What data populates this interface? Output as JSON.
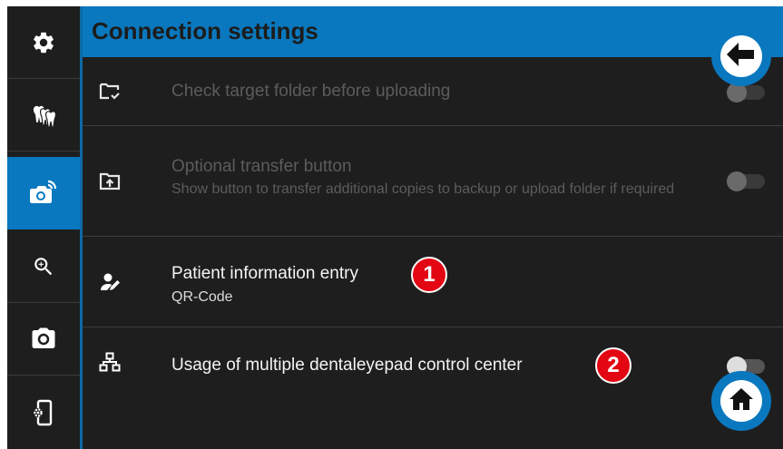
{
  "header": {
    "title": "Connection settings"
  },
  "sidebar": {
    "items": [
      {
        "icon": "gear-icon",
        "active": false
      },
      {
        "icon": "teeth-icon",
        "active": false
      },
      {
        "icon": "wireless-camera-icon",
        "active": true
      },
      {
        "icon": "zoom-in-icon",
        "active": false
      },
      {
        "icon": "camera-icon",
        "active": false
      },
      {
        "icon": "device-settings-icon",
        "active": false
      }
    ]
  },
  "settings": {
    "check_folder": {
      "icon": "folder-check-icon",
      "title": "Check target folder before uploading",
      "enabled": false,
      "toggle_on": false
    },
    "optional_transfer": {
      "icon": "folder-upload-icon",
      "title": "Optional transfer button",
      "subtitle": "Show button to transfer additional copies to backup or upload folder if required",
      "enabled": false,
      "toggle_on": false
    },
    "patient_entry": {
      "icon": "person-edit-icon",
      "title": "Patient information entry",
      "value": "QR-Code",
      "badge": "1"
    },
    "multiple_centers": {
      "icon": "network-icon",
      "title": "Usage of multiple dentaleyepad control center",
      "toggle_on": false,
      "badge": "2"
    }
  },
  "buttons": {
    "back": "back-arrow-icon",
    "home": "home-icon"
  },
  "colors": {
    "accent": "#0a78be",
    "background": "#1e1e1e",
    "badge": "#e30613"
  }
}
